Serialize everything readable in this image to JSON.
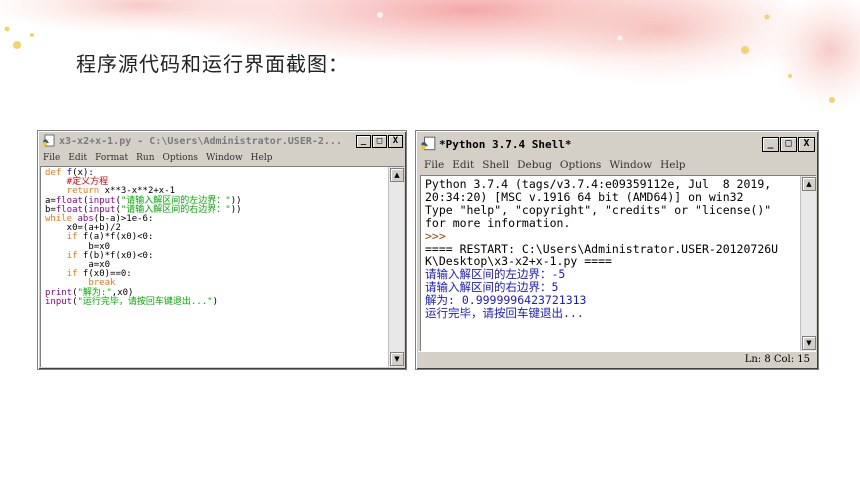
{
  "slide": {
    "title": "程序源代码和运行界面截图："
  },
  "editor_window": {
    "title": "x3-x2+x-1.py - C:\\Users\\Administrator.USER-2...",
    "buttons": {
      "minimize": "_",
      "maximize": "□",
      "close": "X"
    },
    "menu": [
      "File",
      "Edit",
      "Format",
      "Run",
      "Options",
      "Window",
      "Help"
    ],
    "code": {
      "l1_kw": "def",
      "l1_name": " f",
      "l1_rest": "(x):",
      "l2_comment": "    #定义方程",
      "l3_kw": "    return",
      "l3_rest": " x**3-x**2+x-1",
      "l4_a": "a=",
      "l4_fn1": "float",
      "l4_p1": "(",
      "l4_fn2": "input",
      "l4_p2": "(",
      "l4_str": "\"请输入解区间的左边界：\"",
      "l4_end": "))",
      "l5_a": "b=",
      "l5_fn1": "float",
      "l5_p1": "(",
      "l5_fn2": "input",
      "l5_p2": "(",
      "l5_str": "\"请输入解区间的右边界：\"",
      "l5_end": "))",
      "l6_kw": "while",
      "l6_sp": " ",
      "l6_fn": "abs",
      "l6_rest": "(b-a)>1e-6:",
      "l7": "    x0=(a+b)/2",
      "l8_kw": "    if",
      "l8_rest": " f(a)*f(x0)<0:",
      "l9": "        b=x0",
      "l10_kw": "    if",
      "l10_rest": " f(b)*f(x0)<0:",
      "l11": "        a=x0",
      "l12_kw": "    if",
      "l12_rest": " f(x0)==0:",
      "l13_kw": "        break",
      "l14_fn": "print",
      "l14_p": "(",
      "l14_str": "\"解为:\"",
      "l14_end": ",x0)",
      "l15_fn": "input",
      "l15_p": "(",
      "l15_str": "\"运行完毕，请按回车键退出...\"",
      "l15_end": ")"
    }
  },
  "shell_window": {
    "title": "*Python 3.7.4 Shell*",
    "buttons": {
      "minimize": "_",
      "maximize": "□",
      "close": "X"
    },
    "menu": [
      "File",
      "Edit",
      "Shell",
      "Debug",
      "Options",
      "Window",
      "Help"
    ],
    "lines": {
      "l1": "Python 3.7.4 (tags/v3.7.4:e09359112e, Jul  8 2019,",
      "l2": "20:34:20) [MSC v.1916 64 bit (AMD64)] on win32",
      "l3": "Type \"help\", \"copyright\", \"credits\" or \"license()\"",
      "l4": "for more information.",
      "l5": ">>> ",
      "l6": "==== RESTART: C:\\Users\\Administrator.USER-20120726U",
      "l7": "K\\Desktop\\x3-x2+x-1.py ====",
      "l8": "请输入解区间的左边界：-5",
      "l9": "请输入解区间的右边界：5",
      "l10": "解为: 0.9999996423721313",
      "l11": "运行完毕，请按回车键退出..."
    },
    "status": "Ln: 8  Col: 15"
  },
  "icons": [
    "python-file-icon",
    "python-shell-icon",
    "scroll-up-icon",
    "scroll-down-icon"
  ]
}
